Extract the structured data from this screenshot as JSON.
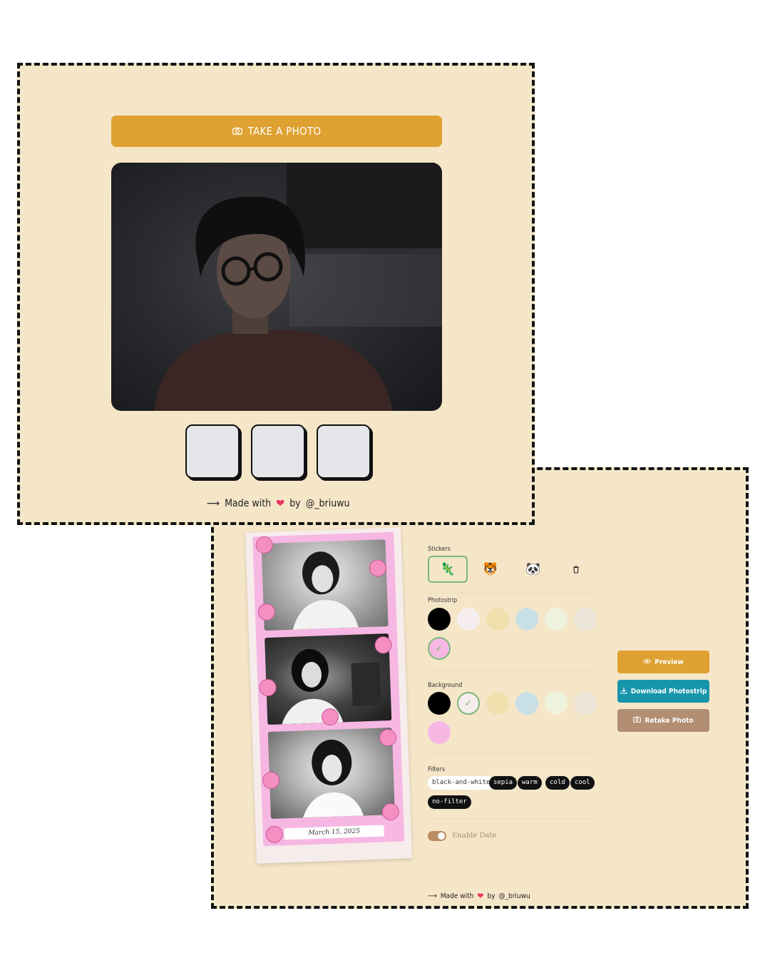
{
  "camera_screen": {
    "take_photo_label": "TAKE A PHOTO",
    "thumbnails": [
      {
        "state": "empty"
      },
      {
        "state": "empty"
      },
      {
        "state": "empty"
      }
    ],
    "credit": {
      "arrow": "⟶",
      "made_with": "Made with",
      "heart": "❤",
      "by": "by",
      "handle": "@_briuwu"
    }
  },
  "editor_screen": {
    "photostrip": {
      "date": "March 15, 2025",
      "filter_applied": "black-and-white",
      "frame_color": "#f6b8e2",
      "background_color": "#f7ecec"
    },
    "stickers": {
      "label": "Stickers",
      "options": [
        {
          "icon": "axolotl-sticker-icon",
          "glyph": "🦎",
          "selected": true
        },
        {
          "icon": "tiger-sticker-icon",
          "glyph": "🐯",
          "selected": false
        },
        {
          "icon": "panda-sticker-icon",
          "glyph": "🐼",
          "selected": false
        },
        {
          "icon": "trash-icon",
          "glyph": "🗑",
          "selected": false
        }
      ]
    },
    "photostrip_colors": {
      "label": "Photostrip",
      "colors": [
        {
          "value": "#000000",
          "selected": false
        },
        {
          "value": "#f6eeee",
          "selected": false
        },
        {
          "value": "#f1e0ae",
          "selected": false
        },
        {
          "value": "#c9dfe6",
          "selected": false
        },
        {
          "value": "#eef3dd",
          "selected": false
        },
        {
          "value": "#ede6da",
          "selected": false
        },
        {
          "value": "#f6b8e2",
          "selected": true
        }
      ]
    },
    "background_colors": {
      "label": "Background",
      "colors": [
        {
          "value": "#000000",
          "selected": false
        },
        {
          "value": "#f6eeee",
          "selected": true
        },
        {
          "value": "#f1e0ae",
          "selected": false
        },
        {
          "value": "#c9dfe6",
          "selected": false
        },
        {
          "value": "#eef3dd",
          "selected": false
        },
        {
          "value": "#ede6da",
          "selected": false
        },
        {
          "value": "#f6b8e2",
          "selected": false
        }
      ]
    },
    "filters": {
      "label": "Filters",
      "options": [
        {
          "label": "black-and-white",
          "active": true
        },
        {
          "label": "sepia",
          "active": false
        },
        {
          "label": "warm",
          "active": false
        },
        {
          "label": "cold",
          "active": false
        },
        {
          "label": "cool",
          "active": false
        },
        {
          "label": "no-filter",
          "active": false
        }
      ]
    },
    "enable_date": {
      "label": "Enable Date",
      "on": true
    },
    "actions": {
      "preview": {
        "label": "Preview",
        "color": "#dfa132"
      },
      "download": {
        "label": "Download Photostrip",
        "color": "#1795aa"
      },
      "retake": {
        "label": "Retake Photo",
        "color": "#b28e73"
      }
    },
    "credit": {
      "arrow": "⟶",
      "made_with": "Made with",
      "heart": "❤",
      "by": "by",
      "handle": "@_briuwu"
    }
  },
  "colors": {
    "panel_bg": "#f5e6c8",
    "heart": "#e8365e"
  }
}
